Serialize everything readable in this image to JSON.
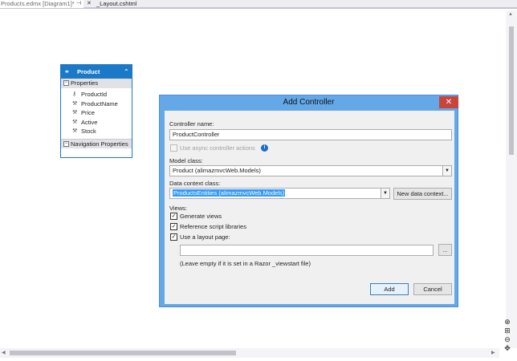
{
  "tabs": {
    "active_label": "Products.edmx [Diagram1]*",
    "other_label": "_Layout.cshtml",
    "pin_glyph": "⊣",
    "close_glyph": "✕"
  },
  "entity": {
    "title": "Product",
    "properties_label": "Properties",
    "properties": [
      "ProductId",
      "ProductName",
      "Price",
      "Active",
      "Stock"
    ],
    "navigation_label": "Navigation Properties",
    "color": "#1c79c7"
  },
  "dialog": {
    "title": "Add Controller",
    "controller_name_label": "Controller name:",
    "controller_name_value": "ProductController",
    "async_label": "Use async controller actions",
    "model_class_label": "Model class:",
    "model_class_value": "Product (alimazmvcWeb.Models)",
    "data_context_label": "Data context class:",
    "data_context_value": "ProductsEntities (alimazmvcWeb.Models)",
    "new_data_context_button": "New data context...",
    "views_label": "Views:",
    "generate_views_label": "Generate views",
    "reference_scripts_label": "Reference script libraries",
    "use_layout_label": "Use a layout page:",
    "layout_path_value": "",
    "browse_button": "...",
    "layout_hint": "(Leave empty if it is set in a Razor _viewstart file)",
    "add_button": "Add",
    "cancel_button": "Cancel",
    "check_glyph": "✓",
    "accent_color": "#64a8e8"
  }
}
